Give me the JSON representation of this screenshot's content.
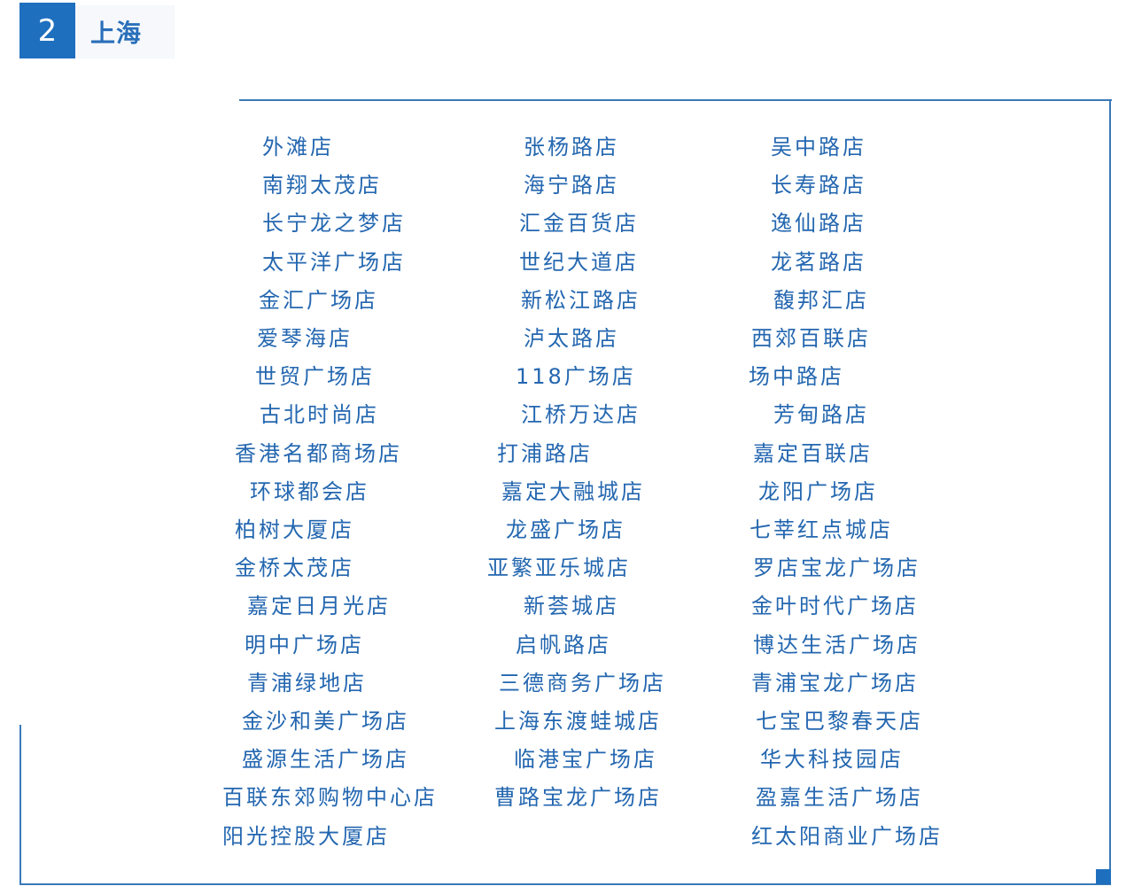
{
  "header": {
    "number": "2",
    "title": "上海"
  },
  "colors": {
    "accent": "#1f6fbf",
    "text": "#2467b0",
    "border": "#3a79b8"
  },
  "stores": {
    "col1": [
      "外滩店",
      "南翔太茂店",
      "长宁龙之梦店",
      "太平洋广场店",
      "金汇广场店",
      "爱琴海店",
      "世贸广场店",
      "古北时尚店",
      "香港名都商场店",
      "环球都会店",
      "柏树大厦店",
      "金桥太茂店",
      "嘉定日月光店",
      "明中广场店",
      "青浦绿地店",
      "金沙和美广场店",
      "盛源生活广场店",
      "百联东郊购物中心店",
      "阳光控股大厦店"
    ],
    "col2": [
      "张杨路店",
      "海宁路店",
      "汇金百货店",
      "世纪大道店",
      "新松江路店",
      "泸太路店",
      "118广场店",
      "江桥万达店",
      "打浦路店",
      "嘉定大融城店",
      "龙盛广场店",
      "亚繁亚乐城店",
      "新荟城店",
      "启帆路店",
      "三德商务广场店",
      "上海东渡蛙城店",
      "临港宝广场店",
      "曹路宝龙广场店"
    ],
    "col3": [
      "吴中路店",
      "长寿路店",
      "逸仙路店",
      "龙茗路店",
      "馥邦汇店",
      "西郊百联店",
      "场中路店",
      "芳甸路店",
      "嘉定百联店",
      "龙阳广场店",
      "七莘红点城店",
      "罗店宝龙广场店",
      "金叶时代广场店",
      "博达生活广场店",
      "青浦宝龙广场店",
      "七宝巴黎春天店",
      "华大科技园店",
      "盈嘉生活广场店",
      "红太阳商业广场店"
    ]
  }
}
